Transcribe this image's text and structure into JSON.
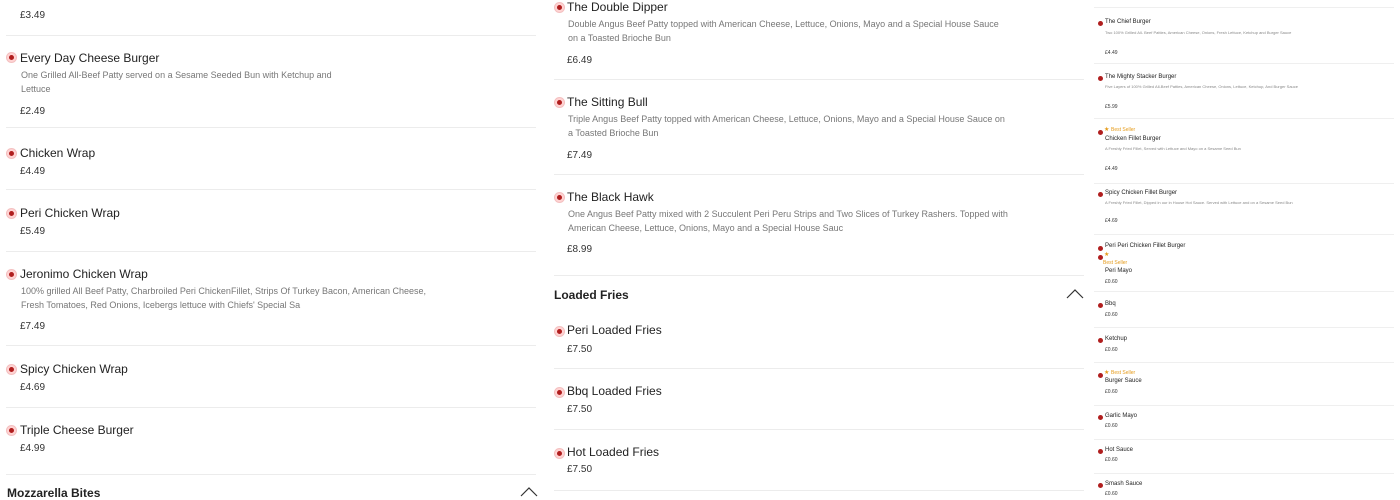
{
  "col1": {
    "top_price": "£3.49",
    "items": [
      {
        "name": "Every Day Cheese Burger",
        "desc": "One Grilled All-Beef Patty served on a Sesame Seeded Bun with Ketchup and Lettuce",
        "price": "£2.49"
      },
      {
        "name": "Chicken Wrap",
        "desc": "",
        "price": "£4.49"
      },
      {
        "name": "Peri Chicken Wrap",
        "desc": "",
        "price": "£5.49"
      },
      {
        "name": "Jeronimo Chicken Wrap",
        "desc": "100% grilled All Beef Patty, Charbroiled Peri ChickenFillet, Strips Of Turkey Bacon, American Cheese, Fresh Tomatoes, Red Onions, Icebergs lettuce with Chiefs' Special Sa",
        "price": "£7.49"
      },
      {
        "name": "Spicy Chicken Wrap",
        "desc": "",
        "price": "£4.69"
      },
      {
        "name": "Triple Cheese Burger",
        "desc": "",
        "price": "£4.99"
      }
    ],
    "section_title": "Mozzarella Bites"
  },
  "col2": {
    "items": [
      {
        "name": "The Double Dipper",
        "desc": "Double Angus Beef Patty topped with American Cheese, Lettuce, Onions, Mayo and a Special House Sauce on a Toasted Brioche Bun",
        "price": "£6.49"
      },
      {
        "name": "The Sitting Bull",
        "desc": "Triple Angus Beef Patty topped with American Cheese, Lettuce, Onions, Mayo and a Special House Sauce on a Toasted Brioche Bun",
        "price": "£7.49"
      },
      {
        "name": "The Black Hawk",
        "desc": "One Angus Beef Patty mixed with 2 Succulent Peri Peru Strips and Two Slices of Turkey Rashers. Topped with American Cheese, Lettuce, Onions, Mayo and a Special House Sauc",
        "price": "£8.99"
      }
    ],
    "section_title": "Loaded Fries",
    "fries": [
      {
        "name": "Peri Loaded Fries",
        "price": "£7.50"
      },
      {
        "name": "Bbq Loaded Fries",
        "price": "£7.50"
      },
      {
        "name": "Hot Loaded Fries",
        "price": "£7.50"
      }
    ]
  },
  "col3": {
    "items": [
      {
        "best": "",
        "name": "The Chief Burger",
        "desc": "Two 100% Grilled All- Beef Patties, American Cheese, Onions, Fresh Lettuce, Ketchup and Burger Sauce",
        "price": "£4.49"
      },
      {
        "best": "",
        "name": "The Mighty Stacker Burger",
        "desc": "Five Layers of 100% Grilled All-Beef Patties, American Cheese, Onions, Lettuce, Ketchup, And Burger Sauce",
        "price": "£5.99"
      },
      {
        "best": "Best Seller",
        "name": "Chicken Fillet Burger",
        "desc": "A Freshly Fried Fillet, Served with Lettuce and Mayo on a Sesame Seed Bun",
        "price": "£4.49"
      },
      {
        "best": "",
        "name": "Spicy Chicken Fillet Burger",
        "desc": "A Freshly Fried Fillet, Dipped in our in House Hot Sauce. Served with Lettuce and on a Sesame Seed Bun",
        "price": "£4.69"
      },
      {
        "best": "",
        "name": "Peri Peri Chicken Fillet Burger",
        "desc": "",
        "price": ""
      },
      {
        "best": "Best Seller",
        "name": "Peri Mayo",
        "desc": "",
        "price": "£0.60"
      },
      {
        "best": "",
        "name": "Bbq",
        "desc": "",
        "price": "£0.60"
      },
      {
        "best": "",
        "name": "Ketchup",
        "desc": "",
        "price": "£0.60"
      },
      {
        "best": "Best Seller",
        "name": "Burger Sauce",
        "desc": "",
        "price": "£0.60"
      },
      {
        "best": "",
        "name": "Garlic Mayo",
        "desc": "",
        "price": "£0.60"
      },
      {
        "best": "",
        "name": "Hot Sauce",
        "desc": "",
        "price": "£0.60"
      },
      {
        "best": "",
        "name": "Smash Sauce",
        "desc": "",
        "price": "£0.60"
      }
    ]
  },
  "colors": {
    "dot": "#b01e1e",
    "best_seller": "#e59b1a"
  }
}
